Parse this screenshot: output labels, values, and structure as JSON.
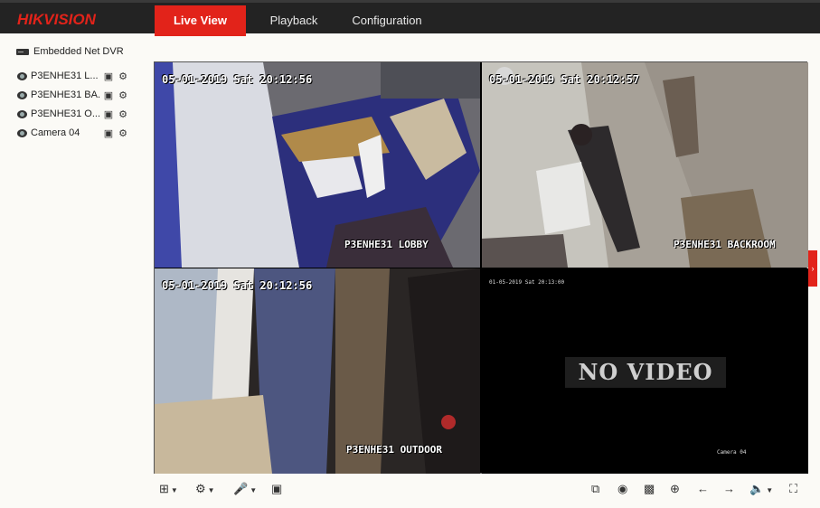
{
  "brand": {
    "logo": "HIKVISION"
  },
  "nav": {
    "tabs": [
      {
        "label": "Live View",
        "active": true
      },
      {
        "label": "Playback",
        "active": false
      },
      {
        "label": "Configuration",
        "active": false
      }
    ]
  },
  "sidebar": {
    "device": "Embedded Net DVR",
    "cameras": [
      {
        "label": "P3ENHE31 L..."
      },
      {
        "label": "P3ENHE31 BA..."
      },
      {
        "label": "P3ENHE31 O..."
      },
      {
        "label": "Camera 04"
      }
    ]
  },
  "tiles": [
    {
      "timestamp": "05-01-2019 Sat 20:12:56",
      "name": "P3ENHE31 LOBBY"
    },
    {
      "timestamp": "05-01-2019 Sat 20:12:57",
      "name": "P3ENHE31 BACKROOM"
    },
    {
      "timestamp": "05-01-2019 Sat 20:12:56",
      "name": "P3ENHE31 OUTDOOR"
    },
    {
      "timestamp": "01-05-2019 Sat 20:13:00",
      "name": "Camera 04",
      "status": "NO VIDEO"
    }
  ],
  "colors": {
    "accent": "#e2231a",
    "topbar": "#232323"
  }
}
